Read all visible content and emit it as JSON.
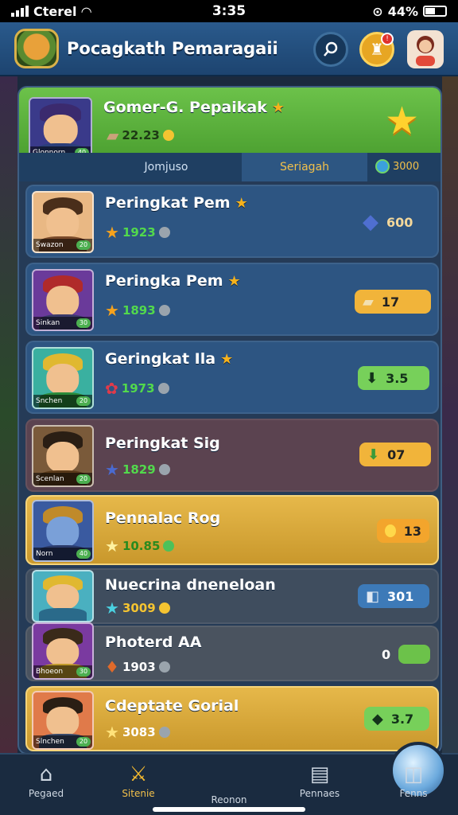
{
  "status": {
    "carrier": "Cterel",
    "time": "3:35",
    "battery": "44%"
  },
  "header": {
    "title": "Pocagkath Pemaragaii",
    "search_icon": "search-icon",
    "achievement_icon": "trophy-icon",
    "profile_icon": "avatar"
  },
  "top_player": {
    "name": "Gomer-G. Pepaikak",
    "score": "22.23",
    "avatar_label": "Glonnorn",
    "level": "40"
  },
  "tabs": {
    "left": "Jomjuso",
    "active": "Seriagah",
    "extra": "3000"
  },
  "rows": [
    {
      "name": "Peringkat Pem",
      "score": "1923",
      "avatar_label": "Swazon",
      "level": "20",
      "value": "600",
      "color": "blue"
    },
    {
      "name": "Peringka Pem",
      "score": "1893",
      "avatar_label": "Sinkan",
      "level": "30",
      "value": "17",
      "color": "blue"
    },
    {
      "name": "Geringkat Ila",
      "score": "1973",
      "avatar_label": "Snchen",
      "level": "20",
      "value": "3.5",
      "color": "blue"
    },
    {
      "name": "Peringkat Sig",
      "score": "1829",
      "avatar_label": "Scenlan",
      "level": "20",
      "value": "07",
      "color": "brown"
    },
    {
      "name": "Pennalac Rog",
      "score": "10.85",
      "avatar_label": "Norn",
      "level": "40",
      "value": "13",
      "color": "gold"
    },
    {
      "name": "Nuecrina dneneloan",
      "score": "3009",
      "avatar_label": "",
      "level": "",
      "value": "301",
      "color": "dark"
    },
    {
      "name": "Photerd AA",
      "score": "1903",
      "avatar_label": "Bhoeon",
      "level": "30",
      "value": "0",
      "color": "gray"
    },
    {
      "name": "Cdeptate Gorial",
      "score": "3083",
      "avatar_label": "Slnchen",
      "level": "20",
      "value": "3.7",
      "color": "gold"
    }
  ],
  "nav": [
    {
      "label": "Pegaed",
      "icon": "home-icon"
    },
    {
      "label": "Sitenie",
      "icon": "battle-icon"
    },
    {
      "label": "Reonon",
      "icon": "globe-icon"
    },
    {
      "label": "Pennaes",
      "icon": "chest-icon"
    },
    {
      "label": "Fenns",
      "icon": "chart-icon"
    }
  ]
}
